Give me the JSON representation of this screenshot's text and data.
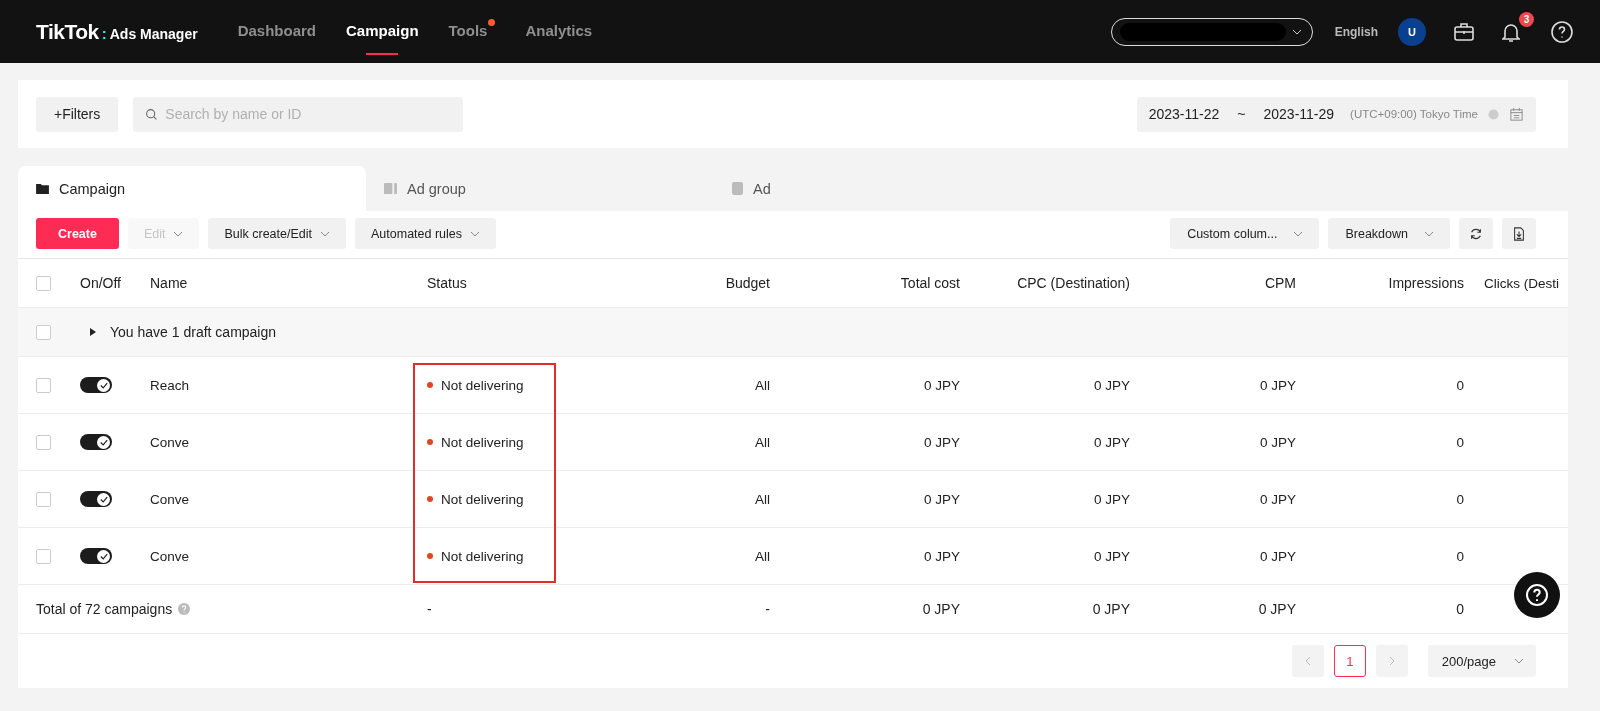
{
  "topbar": {
    "logo": "TikTok",
    "logo_separator": ":",
    "logo_suffix": "Ads Manager",
    "nav": [
      {
        "label": "Dashboard",
        "selected": false,
        "dot": false
      },
      {
        "label": "Campaign",
        "selected": true,
        "dot": false
      },
      {
        "label": "Tools",
        "selected": false,
        "dot": true
      },
      {
        "label": "Analytics",
        "selected": false,
        "dot": false
      }
    ],
    "language": "English",
    "avatar": "U",
    "notification_count": "3"
  },
  "filters": {
    "button": "+Filters",
    "search": {
      "placeholder": "Search by name or ID"
    },
    "date_start": "2023-11-22",
    "date_sep": "~",
    "date_end": "2023-11-29",
    "timezone": "(UTC+09:00) Tokyo Time"
  },
  "tabs": [
    {
      "label": "Campaign",
      "selected": true
    },
    {
      "label": "Ad group",
      "selected": false
    },
    {
      "label": "Ad",
      "selected": false
    }
  ],
  "toolbar": {
    "left": [
      {
        "label": "Create",
        "kind": "primary",
        "disabled": false
      },
      {
        "label": "Edit",
        "kind": "dropdown",
        "disabled": true
      },
      {
        "label": "Bulk create/Edit",
        "kind": "dropdown",
        "disabled": false
      },
      {
        "label": "Automated rules",
        "kind": "dropdown",
        "disabled": false
      }
    ],
    "right": [
      {
        "label": "Custom colum...",
        "kind": "dropdown"
      },
      {
        "label": "Breakdown",
        "kind": "dropdown"
      }
    ]
  },
  "table": {
    "columns": [
      "On/Off",
      "Name",
      "Status",
      "Budget",
      "Total cost",
      "CPC (Destination)",
      "CPM",
      "Impressions",
      "Clicks (Desti"
    ],
    "select_all_checked": false,
    "draft_row": {
      "label": "You have 1 draft campaign",
      "checked": false,
      "expanded": false
    },
    "rows": [
      {
        "checked": false,
        "on": true,
        "name": "Reach",
        "status": "Not delivering",
        "color": "#e0461f",
        "budget": "All",
        "total_cost": "0 JPY",
        "cpc": "0 JPY",
        "cpm": "0 JPY",
        "impressions": "0"
      },
      {
        "checked": false,
        "on": true,
        "name": "Conve",
        "status": "Not delivering",
        "color": "#e0461f",
        "budget": "All",
        "total_cost": "0 JPY",
        "cpc": "0 JPY",
        "cpm": "0 JPY",
        "impressions": "0"
      },
      {
        "checked": false,
        "on": true,
        "name": "Conve",
        "status": "Not delivering",
        "color": "#e0461f",
        "budget": "All",
        "total_cost": "0 JPY",
        "cpc": "0 JPY",
        "cpm": "0 JPY",
        "impressions": "0"
      },
      {
        "checked": false,
        "on": true,
        "name": "Conve",
        "status": "Not delivering",
        "color": "#e0461f",
        "budget": "All",
        "total_cost": "0 JPY",
        "cpc": "0 JPY",
        "cpm": "0 JPY",
        "impressions": "0"
      }
    ],
    "total": {
      "label": "Total of 72 campaigns",
      "status": "-",
      "budget": "-",
      "total_cost": "0 JPY",
      "cpc": "0 JPY",
      "cpm": "0 JPY",
      "impressions": "0"
    }
  },
  "pagination": {
    "pages": [
      {
        "label": "1",
        "selected": true
      }
    ],
    "page_size": "200/page"
  }
}
